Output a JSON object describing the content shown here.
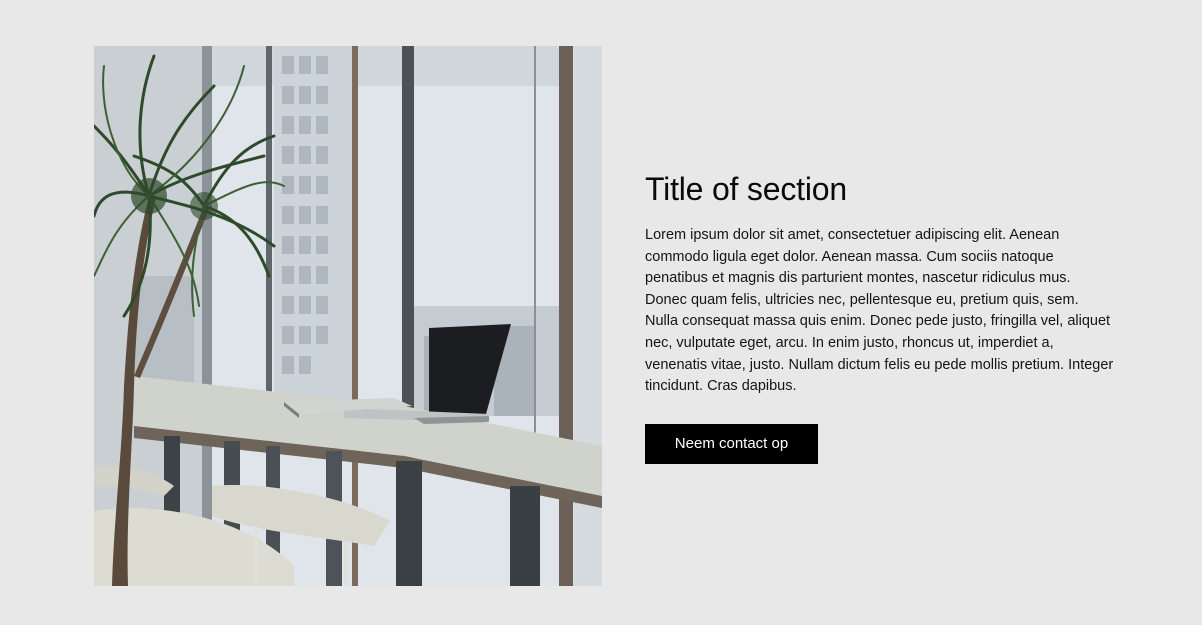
{
  "colors": {
    "page_background": "#e8e8e8",
    "button_background": "#000000",
    "button_text": "#ffffff",
    "heading": "#0a0a0a",
    "body": "#141414"
  },
  "image": {
    "description_icon": "office-photo"
  },
  "section": {
    "title": "Title of section",
    "body": "Lorem ipsum dolor sit amet, consectetuer adipiscing elit. Aenean commodo ligula eget dolor. Aenean massa. Cum sociis natoque penatibus et magnis dis parturient montes, nascetur ridiculus mus. Donec quam felis, ultricies nec, pellentesque eu, pretium quis, sem. Nulla consequat massa quis enim. Donec pede justo, fringilla vel, aliquet nec, vulputate eget, arcu. In enim justo, rhoncus ut, imperdiet a, venenatis vitae, justo. Nullam dictum felis eu pede mollis pretium. Integer tincidunt. Cras dapibus.",
    "cta_label": "Neem contact op"
  }
}
